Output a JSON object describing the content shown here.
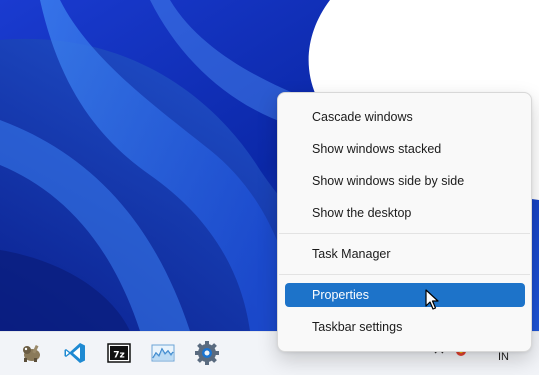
{
  "context_menu": {
    "items": [
      {
        "label": "Cascade windows"
      },
      {
        "label": "Show windows stacked"
      },
      {
        "label": "Show windows side by side"
      },
      {
        "label": "Show the desktop"
      },
      {
        "label": "Task Manager"
      },
      {
        "label": "Properties",
        "selected": true
      },
      {
        "label": "Taskbar settings"
      }
    ]
  },
  "taskbar": {
    "icons": [
      "gimp-icon",
      "vscode-icon",
      "7zip-icon",
      "resource-monitor-icon",
      "settings-gear-icon"
    ],
    "tray": {
      "language": "IN"
    }
  },
  "colors": {
    "accent": "#1d73c9",
    "wallpaper_dark": "#0a2a9e",
    "wallpaper_light": "#2f6fe6"
  }
}
